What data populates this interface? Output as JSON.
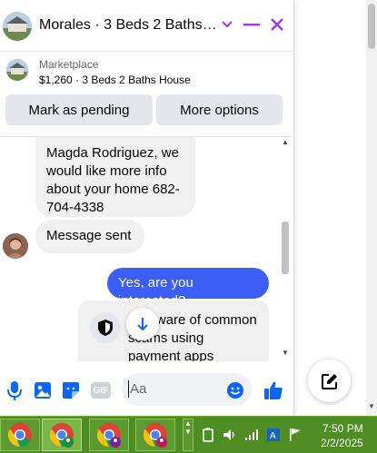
{
  "header": {
    "title": "Morales · 3 Beds 2 Baths H...",
    "accent": "#a033ff"
  },
  "marketplace": {
    "label": "Marketplace",
    "listing": "$1,260 · 3 Beds 2 Baths House",
    "pending_button": "Mark as pending",
    "options_button": "More options"
  },
  "messages": [
    {
      "from": "them",
      "text": "Magda Rodriguez, we would like more info about your home 682-704-4338",
      "lines": [
        "Magda Rodriguez, we",
        "would like more info",
        "about your home 682-",
        "704-4338"
      ]
    },
    {
      "from": "them",
      "text": "Message sent"
    },
    {
      "from": "me",
      "text": "Yes, are you interested?"
    },
    {
      "from": "system",
      "lines": [
        "Be aware of common",
        "scams using",
        "payment apps"
      ]
    }
  ],
  "composer": {
    "placeholder": "Aa",
    "icons": [
      "microphone-icon",
      "photo-icon",
      "sticker-icon",
      "gif-icon",
      "emoji-icon",
      "like-icon"
    ],
    "gif_label": "GIF"
  },
  "taskbar": {
    "time": "7:50 PM",
    "date": "2/2/2025",
    "apps": [
      "chrome",
      "chrome",
      "chrome",
      "chrome"
    ]
  },
  "colors": {
    "messenger_blue": "#0866ff",
    "bubble_out": "#3a5ef6",
    "taskbar": "#4e8c24"
  }
}
